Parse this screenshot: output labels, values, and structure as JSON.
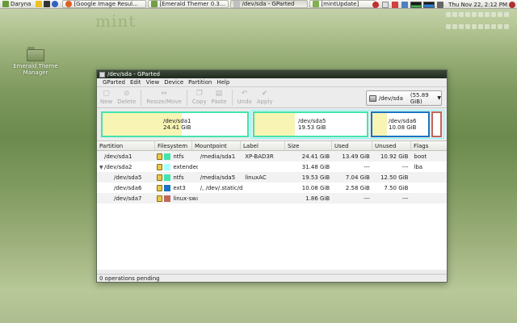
{
  "top_panel": {
    "user_label": "Daryna",
    "tasks": [
      {
        "label": "[Google Image Resul..."
      },
      {
        "label": "[Emerald Themer 0.3..."
      },
      {
        "label": "/dev/sda - GParted"
      },
      {
        "label": "[mintUpdate]"
      }
    ],
    "clock": "Thu Nov 22,  2:12 PM"
  },
  "desktop": {
    "icon_label": "Emerald Theme Manager",
    "mint_logo": "mint"
  },
  "window": {
    "title": "/dev/sda - GParted",
    "menus": [
      "GParted",
      "Edit",
      "View",
      "Device",
      "Partition",
      "Help"
    ],
    "toolbar": {
      "new": "New",
      "delete": "Delete",
      "resize_move": "Resize/Move",
      "copy": "Copy",
      "paste": "Paste",
      "undo": "Undo",
      "apply": "Apply"
    },
    "device": {
      "name": "/dev/sda",
      "size": "(55.89 GiB)"
    },
    "diskmap": [
      {
        "path": "/dev/sda1",
        "size": "24.41 GiB",
        "used_fraction": 0.55
      },
      {
        "path": "/dev/sda5",
        "size": "19.53 GiB",
        "used_fraction": 0.36
      },
      {
        "path": "/dev/sda6",
        "size": "10.08 GiB",
        "used_fraction": 0.26
      }
    ],
    "columns": [
      "Partition",
      "Filesystem",
      "Mountpoint",
      "Label",
      "Size",
      "Used",
      "Unused",
      "Flags"
    ],
    "rows": [
      {
        "partition": "/dev/sda1",
        "filesystem": "ntfs",
        "mountpoint": "/media/sda1",
        "label": "XP-BAD3R",
        "size": "24.41 GiB",
        "used": "13.49 GiB",
        "unused": "10.92 GiB",
        "flags": "boot",
        "fs_color": "#42e5ac",
        "indent": 0
      },
      {
        "partition": "/dev/sda2",
        "filesystem": "extended",
        "mountpoint": "",
        "label": "",
        "size": "31.48 GiB",
        "used": "---",
        "unused": "---",
        "flags": "lba",
        "fs_color": "#a9ffff",
        "indent": 0
      },
      {
        "partition": "/dev/sda5",
        "filesystem": "ntfs",
        "mountpoint": "/media/sda5",
        "label": "linuxAC",
        "size": "19.53 GiB",
        "used": "7.04 GiB",
        "unused": "12.50 GiB",
        "flags": "",
        "fs_color": "#42e5ac",
        "indent": 1
      },
      {
        "partition": "/dev/sda6",
        "filesystem": "ext3",
        "mountpoint": "/, /dev/.static/dev",
        "label": "",
        "size": "10.08 GiB",
        "used": "2.58 GiB",
        "unused": "7.50 GiB",
        "flags": "",
        "fs_color": "#1974c1",
        "indent": 1
      },
      {
        "partition": "/dev/sda7",
        "filesystem": "linux-swap",
        "mountpoint": "",
        "label": "",
        "size": "1.86 GiB",
        "used": "---",
        "unused": "---",
        "flags": "",
        "fs_color": "#c1665a",
        "indent": 1
      }
    ],
    "status": "0 operations pending"
  },
  "colors": {
    "sda1_border": "#42e5ac",
    "sda5_border": "#42e5ac",
    "sda6_border": "#1974c1",
    "sda7_border": "#c1665a",
    "extended_border": "#7dfcfe"
  }
}
